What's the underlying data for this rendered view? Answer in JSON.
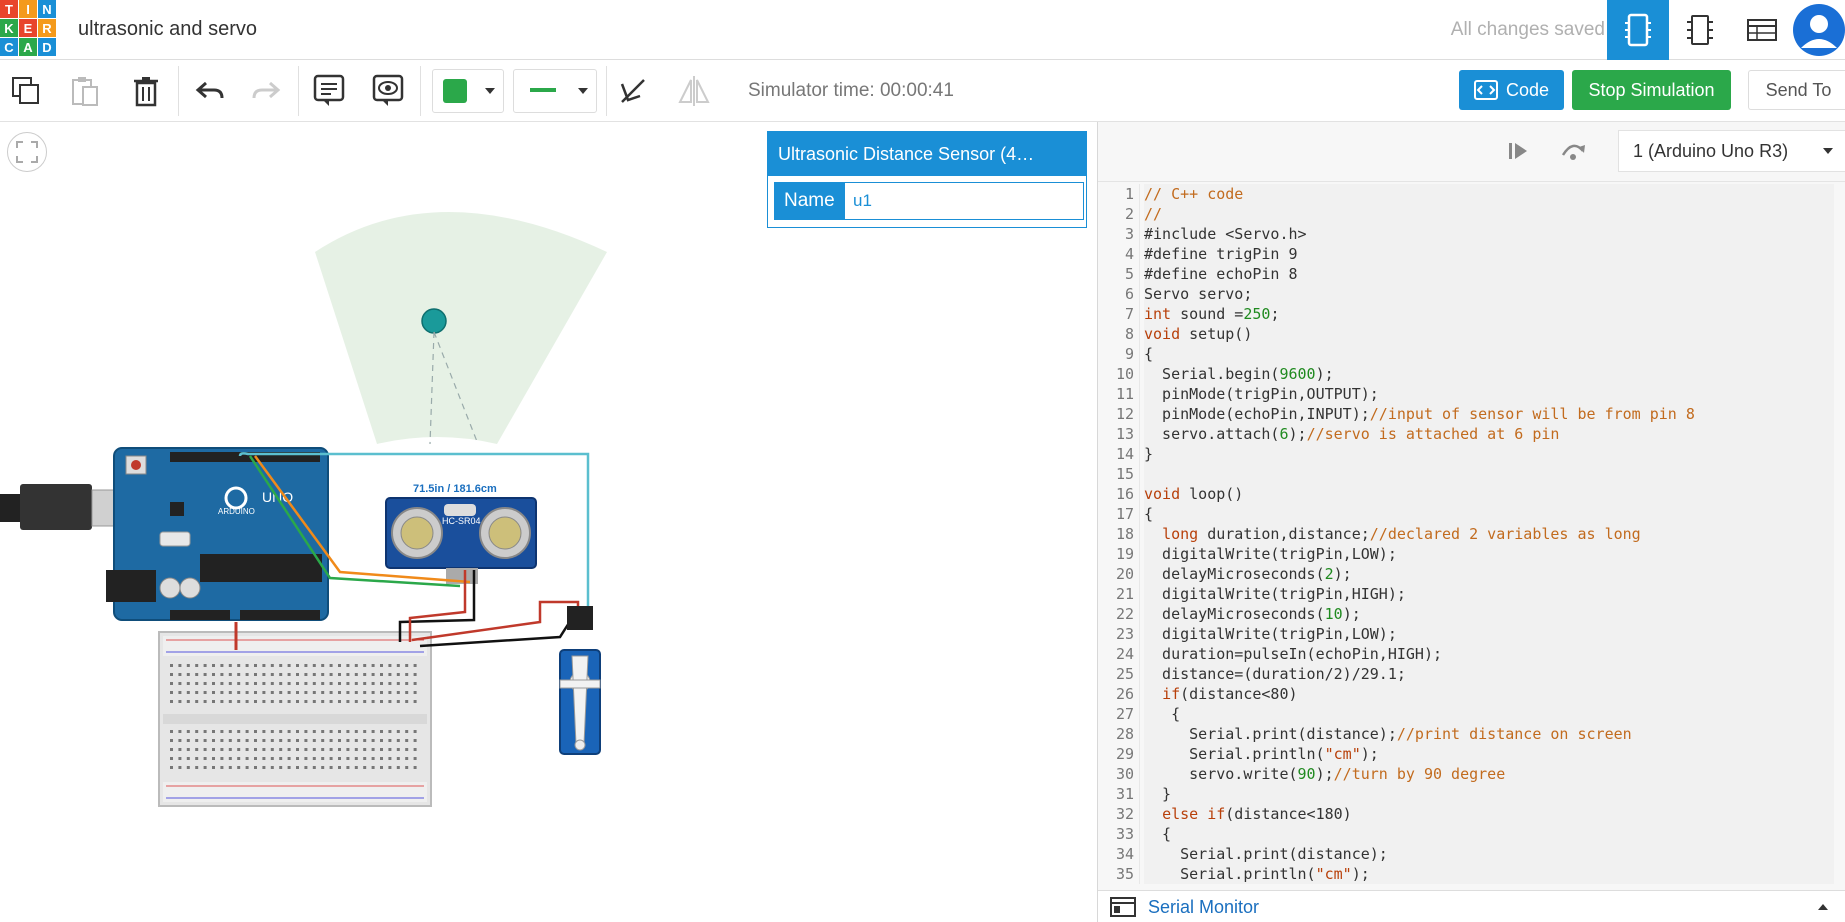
{
  "header": {
    "logo_letters": [
      "T",
      "I",
      "N",
      "K",
      "E",
      "R",
      "C",
      "A",
      "D"
    ],
    "logo_colors": [
      "#e8452c",
      "#f49a1c",
      "#1a8fd6",
      "#2ba84a",
      "#e8452c",
      "#f49a1c",
      "#1a8fd6",
      "#2ba84a",
      "#1a8fd6"
    ],
    "project_title": "ultrasonic and servo",
    "save_status": "All changes saved"
  },
  "toolbar": {
    "simulator_time": "Simulator time: 00:00:41",
    "code_label": "Code",
    "stop_label": "Stop Simulation",
    "send_label": "Send To",
    "fill_color": "#2ba84a",
    "wire_color": "#2ba84a"
  },
  "inspector": {
    "title": "Ultrasonic Distance Sensor (4…",
    "name_label": "Name",
    "name_value": "u1"
  },
  "canvas": {
    "distance_readout": "71.5in / 181.6cm",
    "sensor_model": "HC-SR04",
    "board_brand": "ARDUINO",
    "board_model": "UNO"
  },
  "code_panel": {
    "board": "1 (Arduino Uno R3)",
    "serial_monitor": "Serial Monitor",
    "line_numbers": [
      "1",
      "2",
      "3",
      "4",
      "5",
      "6",
      "7",
      "8",
      "9",
      "10",
      "11",
      "12",
      "13",
      "14",
      "15",
      "16",
      "17",
      "18",
      "19",
      "20",
      "21",
      "22",
      "23",
      "24",
      "25",
      "26",
      "27",
      "28",
      "29",
      "30",
      "31",
      "32",
      "33",
      "34",
      "35"
    ],
    "lines": [
      {
        "text": "// C++ code",
        "kind": "cm"
      },
      {
        "text": "//",
        "kind": "cm"
      },
      {
        "text": "#include <Servo.h>",
        "kind": "pp"
      },
      {
        "text": "#define trigPin 9",
        "kind": "pp"
      },
      {
        "text": "#define echoPin 8",
        "kind": "pp"
      },
      {
        "text": "Servo servo;",
        "kind": "plain"
      },
      {
        "text": "int sound =250;",
        "kind": "plain"
      },
      {
        "text": "void setup()",
        "kind": "plain"
      },
      {
        "text": "{",
        "kind": "plain"
      },
      {
        "text": "  Serial.begin(9600);",
        "kind": "plain"
      },
      {
        "text": "  pinMode(trigPin,OUTPUT);",
        "kind": "plain"
      },
      {
        "text": "  pinMode(echoPin,INPUT);//input of sensor will be from pin 8",
        "kind": "plain"
      },
      {
        "text": "  servo.attach(6);//servo is attached at 6 pin",
        "kind": "plain"
      },
      {
        "text": "}",
        "kind": "plain"
      },
      {
        "text": "",
        "kind": "plain"
      },
      {
        "text": "void loop()",
        "kind": "plain"
      },
      {
        "text": "{",
        "kind": "plain"
      },
      {
        "text": "  long duration,distance;//declared 2 variables as long",
        "kind": "plain"
      },
      {
        "text": "  digitalWrite(trigPin,LOW);",
        "kind": "plain"
      },
      {
        "text": "  delayMicroseconds(2);",
        "kind": "plain"
      },
      {
        "text": "  digitalWrite(trigPin,HIGH);",
        "kind": "plain"
      },
      {
        "text": "  delayMicroseconds(10);",
        "kind": "plain"
      },
      {
        "text": "  digitalWrite(trigPin,LOW);",
        "kind": "plain"
      },
      {
        "text": "  duration=pulseIn(echoPin,HIGH);",
        "kind": "plain"
      },
      {
        "text": "  distance=(duration/2)/29.1;",
        "kind": "plain"
      },
      {
        "text": "  if(distance<80)",
        "kind": "plain"
      },
      {
        "text": "   {",
        "kind": "plain"
      },
      {
        "text": "     Serial.print(distance);//print distance on screen",
        "kind": "plain"
      },
      {
        "text": "     Serial.println(\"cm\");",
        "kind": "plain"
      },
      {
        "text": "     servo.write(90);//turn by 90 degree",
        "kind": "plain"
      },
      {
        "text": "  }",
        "kind": "plain"
      },
      {
        "text": "  else if(distance<180)",
        "kind": "plain"
      },
      {
        "text": "  {",
        "kind": "plain"
      },
      {
        "text": "    Serial.print(distance);",
        "kind": "plain"
      },
      {
        "text": "    Serial.println(\"cm\");",
        "kind": "plain"
      }
    ]
  }
}
